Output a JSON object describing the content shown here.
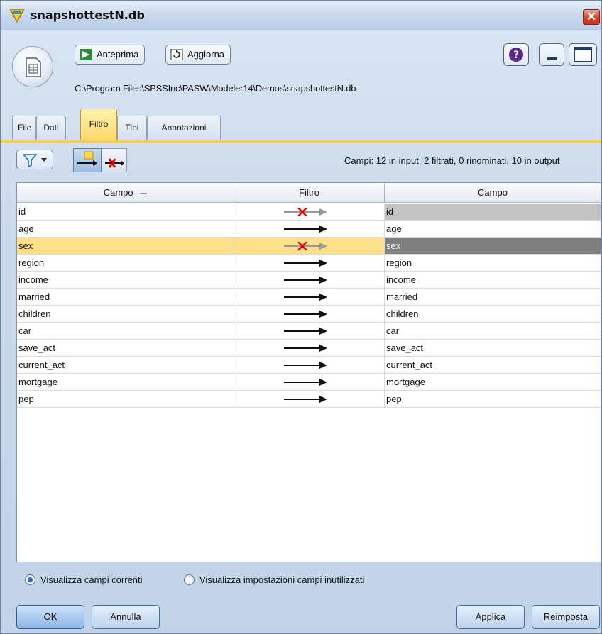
{
  "window": {
    "title": "snapshottestN.db",
    "close_symbol": "✕"
  },
  "toolbar": {
    "preview_label": "Anteprima",
    "refresh_label": "Aggiorna",
    "help_symbol": "?",
    "path": "C:\\Program Files\\SPSSInc\\PASW\\Modeler14\\Demos\\snapshottestN.db"
  },
  "tabs": [
    {
      "label": "File"
    },
    {
      "label": "Dati"
    },
    {
      "label": "Filtro",
      "active": true
    },
    {
      "label": "Tipi"
    },
    {
      "label": "Annotazioni"
    }
  ],
  "filter": {
    "summary": "Campi: 12 in input, 2 filtrati, 0 rinominati, 10 in output"
  },
  "table": {
    "headers": [
      "Campo",
      "Filtro",
      "Campo"
    ],
    "rows": [
      {
        "in": "id",
        "filtered": true,
        "out": "id"
      },
      {
        "in": "age",
        "filtered": false,
        "out": "age"
      },
      {
        "in": "sex",
        "filtered": true,
        "out": "sex",
        "selected": true
      },
      {
        "in": "region",
        "filtered": false,
        "out": "region"
      },
      {
        "in": "income",
        "filtered": false,
        "out": "income"
      },
      {
        "in": "married",
        "filtered": false,
        "out": "married"
      },
      {
        "in": "children",
        "filtered": false,
        "out": "children"
      },
      {
        "in": "car",
        "filtered": false,
        "out": "car"
      },
      {
        "in": "save_act",
        "filtered": false,
        "out": "save_act"
      },
      {
        "in": "current_act",
        "filtered": false,
        "out": "current_act"
      },
      {
        "in": "mortgage",
        "filtered": false,
        "out": "mortgage"
      },
      {
        "in": "pep",
        "filtered": false,
        "out": "pep"
      }
    ]
  },
  "options": {
    "radio_current": "Visualizza campi correnti",
    "radio_unused": "Visualizza impostazioni campi inutilizzati",
    "selected": "current"
  },
  "buttons": {
    "ok": "OK",
    "cancel": "Annulla",
    "apply": "Applica",
    "reset": "Reimposta"
  },
  "colors": {
    "selected_row": "#ffe08a",
    "active_tab": "#ffd86a",
    "filtered_cross": "#e00000"
  }
}
